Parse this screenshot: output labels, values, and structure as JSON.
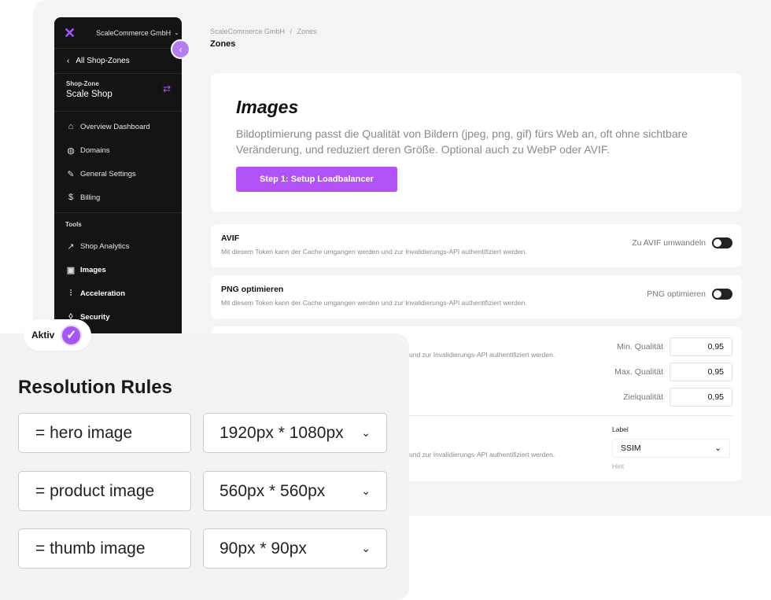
{
  "sidebar": {
    "org": "ScaleCommerce GmbH",
    "back_label": "All Shop-Zones",
    "shop_label": "Shop-Zone",
    "shop_name": "Scale Shop",
    "items": [
      {
        "label": "Overview Dashboard",
        "icon": "home-icon"
      },
      {
        "label": "Domains",
        "icon": "globe-icon"
      },
      {
        "label": "General Settings",
        "icon": "wrench-icon"
      },
      {
        "label": "Billing",
        "icon": "dollar-icon"
      }
    ],
    "tools_title": "Tools",
    "tools": [
      {
        "label": "Shop Analytics",
        "icon": "trend-icon"
      },
      {
        "label": "Images",
        "icon": "image-icon"
      },
      {
        "label": "Acceleration",
        "icon": "sliders-icon"
      },
      {
        "label": "Security",
        "icon": "shield-icon"
      }
    ]
  },
  "breadcrumb": {
    "org": "ScaleCommerce GmbH",
    "sep": "/",
    "page": "Zones"
  },
  "page_title": "Zones",
  "hero": {
    "title": "Images",
    "description": "Bildoptimierung passt die Qualität von Bildern (jpeg, png, gif) fürs Web an, oft ohne sichtbare Veränderung, und reduziert deren Größe. Optional auch zu WebP oder AVIF.",
    "button": "Step 1: Setup Loadbalancer"
  },
  "options": [
    {
      "title": "AVIF",
      "desc": "Mit diesem Token kann der Cache umgangen werden und zur Invalidierungs-API authentifiziert werden.",
      "toggle_label": "Zu AVIF umwandeln"
    },
    {
      "title": "PNG optimieren",
      "desc": "Mit diesem Token kann der Cache umgangen werden und zur Invalidierungs-API authentifiziert werden.",
      "toggle_label": "PNG optimieren"
    }
  ],
  "quality": {
    "desc_1": "und zur Invalidierungs-API authentifiziert werden.",
    "min_label": "Min. Qualität",
    "min_value": "0,95",
    "max_label": "Max. Qualität",
    "max_value": "0,95",
    "target_label": "Zielqualität",
    "target_value": "0,95",
    "desc_2": "und zur Invalidierungs-API authentifiziert werden.",
    "select_label": "Label",
    "select_value": "SSIM",
    "select_hint": "Hint"
  },
  "overlay": {
    "badge": "Aktiv",
    "title": "Resolution Rules",
    "rules": [
      {
        "name": "= hero image",
        "size": "1920px * 1080px"
      },
      {
        "name": "= product image",
        "size": "560px * 560px"
      },
      {
        "name": "= thumb image",
        "size": "90px * 90px"
      }
    ]
  },
  "colors": {
    "accent": "#a855f7",
    "sidebar": "#141414",
    "button": "#b254f5"
  }
}
